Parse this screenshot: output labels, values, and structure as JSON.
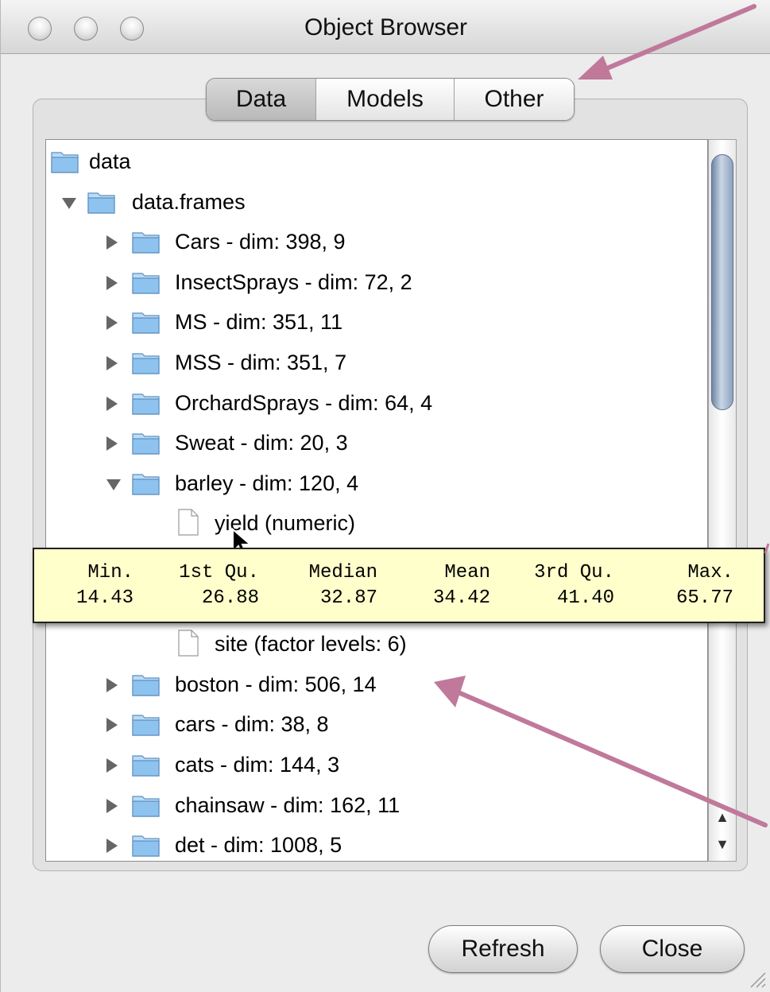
{
  "window": {
    "title": "Object Browser"
  },
  "tabs": [
    {
      "label": "Data",
      "selected": true
    },
    {
      "label": "Models",
      "selected": false
    },
    {
      "label": "Other",
      "selected": false
    }
  ],
  "tree": [
    {
      "label": "data",
      "level": 0,
      "icon": "folder-icon",
      "expander": "none"
    },
    {
      "label": "data.frames",
      "level": 1,
      "icon": "folder-icon",
      "expander": "open"
    },
    {
      "label": "Cars  - dim: 398, 9",
      "level": 2,
      "icon": "folder-icon",
      "expander": "closed"
    },
    {
      "label": "InsectSprays  - dim: 72, 2",
      "level": 2,
      "icon": "folder-icon",
      "expander": "closed"
    },
    {
      "label": "MS  - dim: 351, 11",
      "level": 2,
      "icon": "folder-icon",
      "expander": "closed"
    },
    {
      "label": "MSS  - dim: 351, 7",
      "level": 2,
      "icon": "folder-icon",
      "expander": "closed"
    },
    {
      "label": "OrchardSprays  - dim: 64, 4",
      "level": 2,
      "icon": "folder-icon",
      "expander": "closed"
    },
    {
      "label": "Sweat  - dim: 20, 3",
      "level": 2,
      "icon": "folder-icon",
      "expander": "closed"
    },
    {
      "label": "barley  - dim: 120, 4",
      "level": 2,
      "icon": "folder-icon",
      "expander": "open"
    },
    {
      "label": "yield  (numeric)",
      "level": 3,
      "icon": "document-icon",
      "expander": "none"
    },
    {
      "label": "",
      "level": 3,
      "icon": "document-icon",
      "expander": "none"
    },
    {
      "label": "",
      "level": 3,
      "icon": "document-icon",
      "expander": "none"
    },
    {
      "label": "site  (factor  levels: 6)",
      "level": 3,
      "icon": "document-icon",
      "expander": "none"
    },
    {
      "label": "boston  - dim: 506, 14",
      "level": 2,
      "icon": "folder-icon",
      "expander": "closed"
    },
    {
      "label": "cars  - dim: 38, 8",
      "level": 2,
      "icon": "folder-icon",
      "expander": "closed"
    },
    {
      "label": "cats  - dim: 144, 3",
      "level": 2,
      "icon": "folder-icon",
      "expander": "closed"
    },
    {
      "label": "chainsaw  - dim: 162, 11",
      "level": 2,
      "icon": "folder-icon",
      "expander": "closed"
    },
    {
      "label": "det  - dim: 1008, 5",
      "level": 2,
      "icon": "folder-icon",
      "expander": "closed"
    }
  ],
  "tooltip": {
    "headers": [
      "Min.",
      "1st Qu.",
      "Median",
      "Mean",
      "3rd Qu.",
      "Max."
    ],
    "values": [
      "14.43",
      "26.88",
      "32.87",
      "34.42",
      "41.40",
      "65.77"
    ]
  },
  "buttons": {
    "refresh": "Refresh",
    "close": "Close"
  },
  "scrollbar": {
    "up_icon": "▲",
    "down_icon": "▼"
  },
  "colors": {
    "annotation_arrow": "#c0799a",
    "tooltip_bg": "#ffffcc",
    "folder": "#8fc3ef"
  }
}
